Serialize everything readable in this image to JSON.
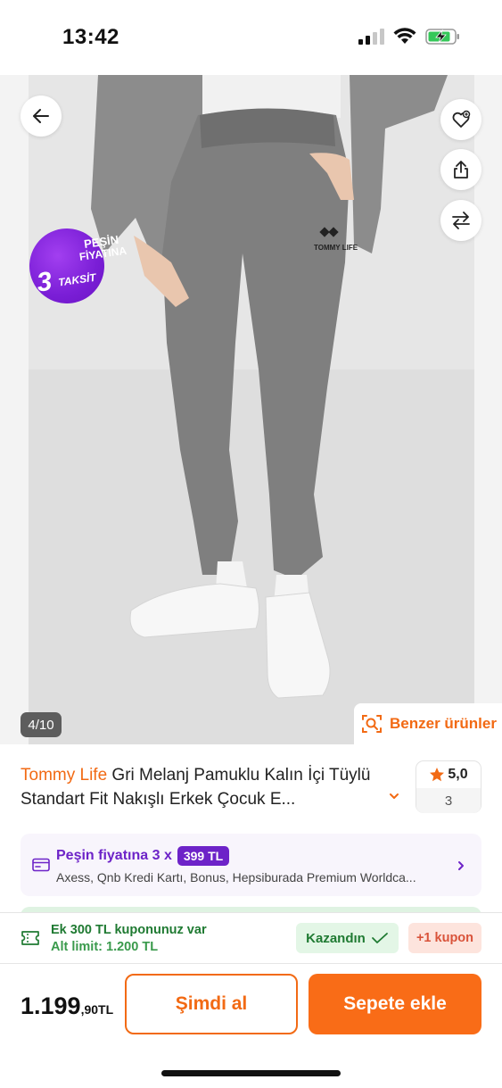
{
  "status_bar": {
    "time": "13:42"
  },
  "gallery": {
    "badge": {
      "line1": "PEŞİN",
      "line2": "FİYATINA",
      "number": "3",
      "line4": "TAKSİT"
    },
    "counter": "4/10",
    "similar_label": "Benzer ürünler",
    "product_logo_text": "TOMMY LIFE"
  },
  "product": {
    "brand": "Tommy Life",
    "title": "Gri Melanj Pamuklu Kalın İçi Tüylü Standart Fit Nakışlı Erkek Çocuk E...",
    "rating": "5,0",
    "review_count": "3"
  },
  "installment": {
    "label": "Peşin fiyatına 3 x",
    "amount": "399 TL",
    "banks": "Axess, Qnb Kredi Kartı, Bonus, Hepsiburada Premium Worldca..."
  },
  "coupon": {
    "title": "Ek 300 TL kuponunuz var",
    "limit": "Alt limit: 1.200 TL",
    "won_label": "Kazandın",
    "more_label": "+1 kupon"
  },
  "purchase": {
    "price_main": "1.199",
    "price_decimal": ",90TL",
    "buy_now": "Şimdi al",
    "add_to_cart": "Sepete ekle"
  },
  "colors": {
    "accent": "#f26a14",
    "purple": "#6d23c8",
    "green": "#1f7a32"
  }
}
